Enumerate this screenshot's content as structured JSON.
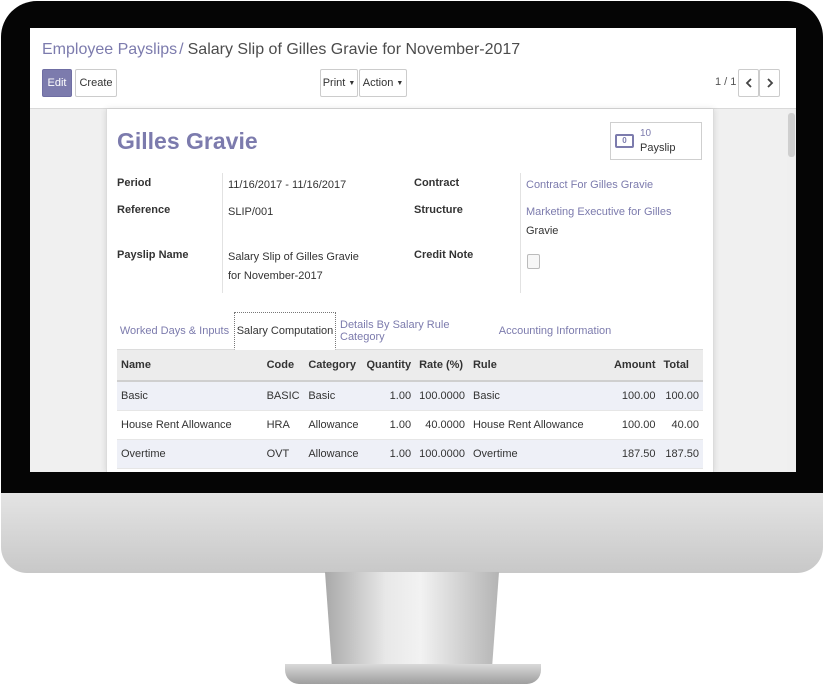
{
  "breadcrumb": {
    "parent": "Employee Payslips",
    "separator": "/",
    "current": "Salary Slip of Gilles Gravie for November-2017"
  },
  "toolbar": {
    "edit_label": "Edit",
    "create_label": "Create",
    "print_label": "Print",
    "action_label": "Action"
  },
  "pager": {
    "value": "1 / 1",
    "prev_icon": "chevron-left-icon",
    "next_icon": "chevron-right-icon"
  },
  "record": {
    "employee_name": "Gilles Gravie",
    "smart_button": {
      "count": "10",
      "label": "Payslip",
      "icon": "money-icon"
    },
    "fields": {
      "period": {
        "label": "Period",
        "value": "11/16/2017 - 11/16/2017"
      },
      "reference": {
        "label": "Reference",
        "value": "SLIP/001"
      },
      "payslip_name": {
        "label": "Payslip Name",
        "value": "Salary Slip of Gilles Gravie for November-2017"
      },
      "contract": {
        "label": "Contract",
        "value": "Contract For Gilles Gravie"
      },
      "structure": {
        "label": "Structure",
        "value_link": "Marketing Executive for Gilles",
        "value_rest": "Gravie"
      },
      "credit_note": {
        "label": "Credit Note",
        "checked": false
      }
    }
  },
  "tabs": [
    {
      "label": "Worked Days & Inputs",
      "active": false
    },
    {
      "label": "Salary Computation",
      "active": true
    },
    {
      "label": "Details By Salary Rule Category",
      "active": false
    },
    {
      "label": "Accounting Information",
      "active": false
    }
  ],
  "salary_table": {
    "columns": [
      "Name",
      "Code",
      "Category",
      "Quantity",
      "Rate (%)",
      "Rule",
      "Amount",
      "Total"
    ],
    "rows": [
      [
        "Basic",
        "BASIC",
        "Basic",
        "1.00",
        "100.0000",
        "Basic",
        "100.00",
        "100.00"
      ],
      [
        "House Rent Allowance",
        "HRA",
        "Allowance",
        "1.00",
        "40.0000",
        "House Rent Allowance",
        "100.00",
        "40.00"
      ],
      [
        "Overtime",
        "OVT",
        "Allowance",
        "1.00",
        "100.0000",
        "Overtime",
        "187.50",
        "187.50"
      ]
    ]
  },
  "colors": {
    "accent": "#7c7bad",
    "text": "#333333",
    "monitor_bezel": "#050505",
    "monitor_body": "#d6d6d6"
  }
}
